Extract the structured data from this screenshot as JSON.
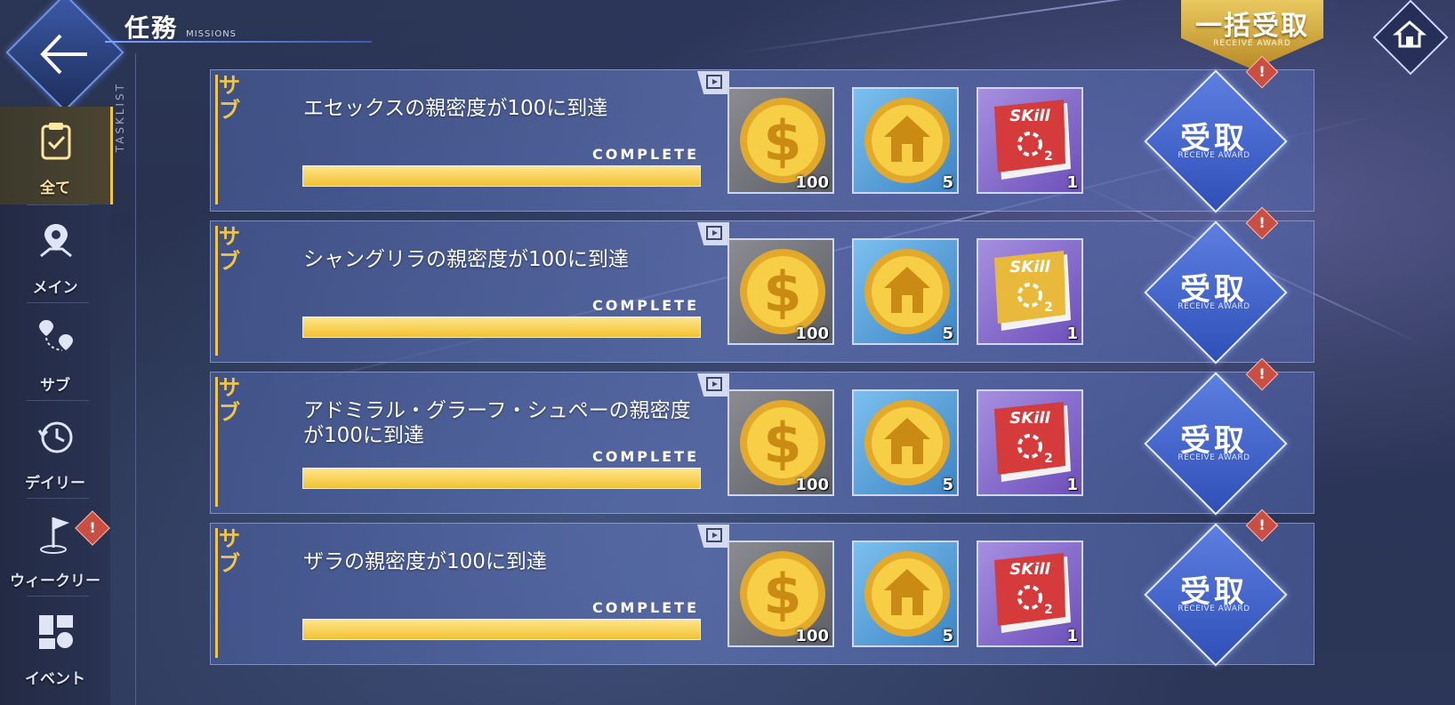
{
  "header": {
    "title": "任務",
    "subtitle": "MISSIONS",
    "bulk_claim_label": "一括受取",
    "bulk_claim_sub": "RECEIVE AWARD"
  },
  "sidebar": {
    "tasklist_label": "TASKLIST",
    "items": [
      {
        "label": "全て",
        "icon": "clipboard-check-icon",
        "active": true
      },
      {
        "label": "メイン",
        "icon": "map-pin-icon"
      },
      {
        "label": "サブ",
        "icon": "route-pins-icon"
      },
      {
        "label": "デイリー",
        "icon": "history-clock-icon"
      },
      {
        "label": "ウィークリー",
        "icon": "flag-icon",
        "alert": "!"
      },
      {
        "label": "イベント",
        "icon": "event-grid-icon"
      }
    ]
  },
  "missions": [
    {
      "tag": "サブ",
      "title": "エセックスの親密度が100に到達",
      "status": "COMPLETE",
      "progress": 1.0,
      "rewards": [
        {
          "icon": "gold-coin-icon",
          "qty": "100"
        },
        {
          "icon": "oil-home-coin-icon",
          "qty": "5"
        },
        {
          "icon": "skill-book-red-icon",
          "qty": "1"
        }
      ],
      "claim_label": "受取",
      "claim_sub": "RECEIVE AWARD",
      "alert": "!"
    },
    {
      "tag": "サブ",
      "title": "シャングリラの親密度が100に到達",
      "status": "COMPLETE",
      "progress": 1.0,
      "rewards": [
        {
          "icon": "gold-coin-icon",
          "qty": "100"
        },
        {
          "icon": "oil-home-coin-icon",
          "qty": "5"
        },
        {
          "icon": "skill-book-yellow-icon",
          "qty": "1"
        }
      ],
      "claim_label": "受取",
      "claim_sub": "RECEIVE AWARD",
      "alert": "!"
    },
    {
      "tag": "サブ",
      "title": "アドミラル・グラーフ・シュペーの親密度が100に到達",
      "status": "COMPLETE",
      "progress": 1.0,
      "rewards": [
        {
          "icon": "gold-coin-icon",
          "qty": "100"
        },
        {
          "icon": "oil-home-coin-icon",
          "qty": "5"
        },
        {
          "icon": "skill-book-red-icon",
          "qty": "1"
        }
      ],
      "claim_label": "受取",
      "claim_sub": "RECEIVE AWARD",
      "alert": "!"
    },
    {
      "tag": "サブ",
      "title": "ザラの親密度が100に到達",
      "status": "COMPLETE",
      "progress": 1.0,
      "rewards": [
        {
          "icon": "gold-coin-icon",
          "qty": "100"
        },
        {
          "icon": "oil-home-coin-icon",
          "qty": "5"
        },
        {
          "icon": "skill-book-red-icon",
          "qty": "1"
        }
      ],
      "claim_label": "受取",
      "claim_sub": "RECEIVE AWARD",
      "alert": "!"
    }
  ],
  "colors": {
    "accent_gold": "#f3c544",
    "claim_blue": "#3f62cc",
    "alert_red": "#c94f43"
  }
}
